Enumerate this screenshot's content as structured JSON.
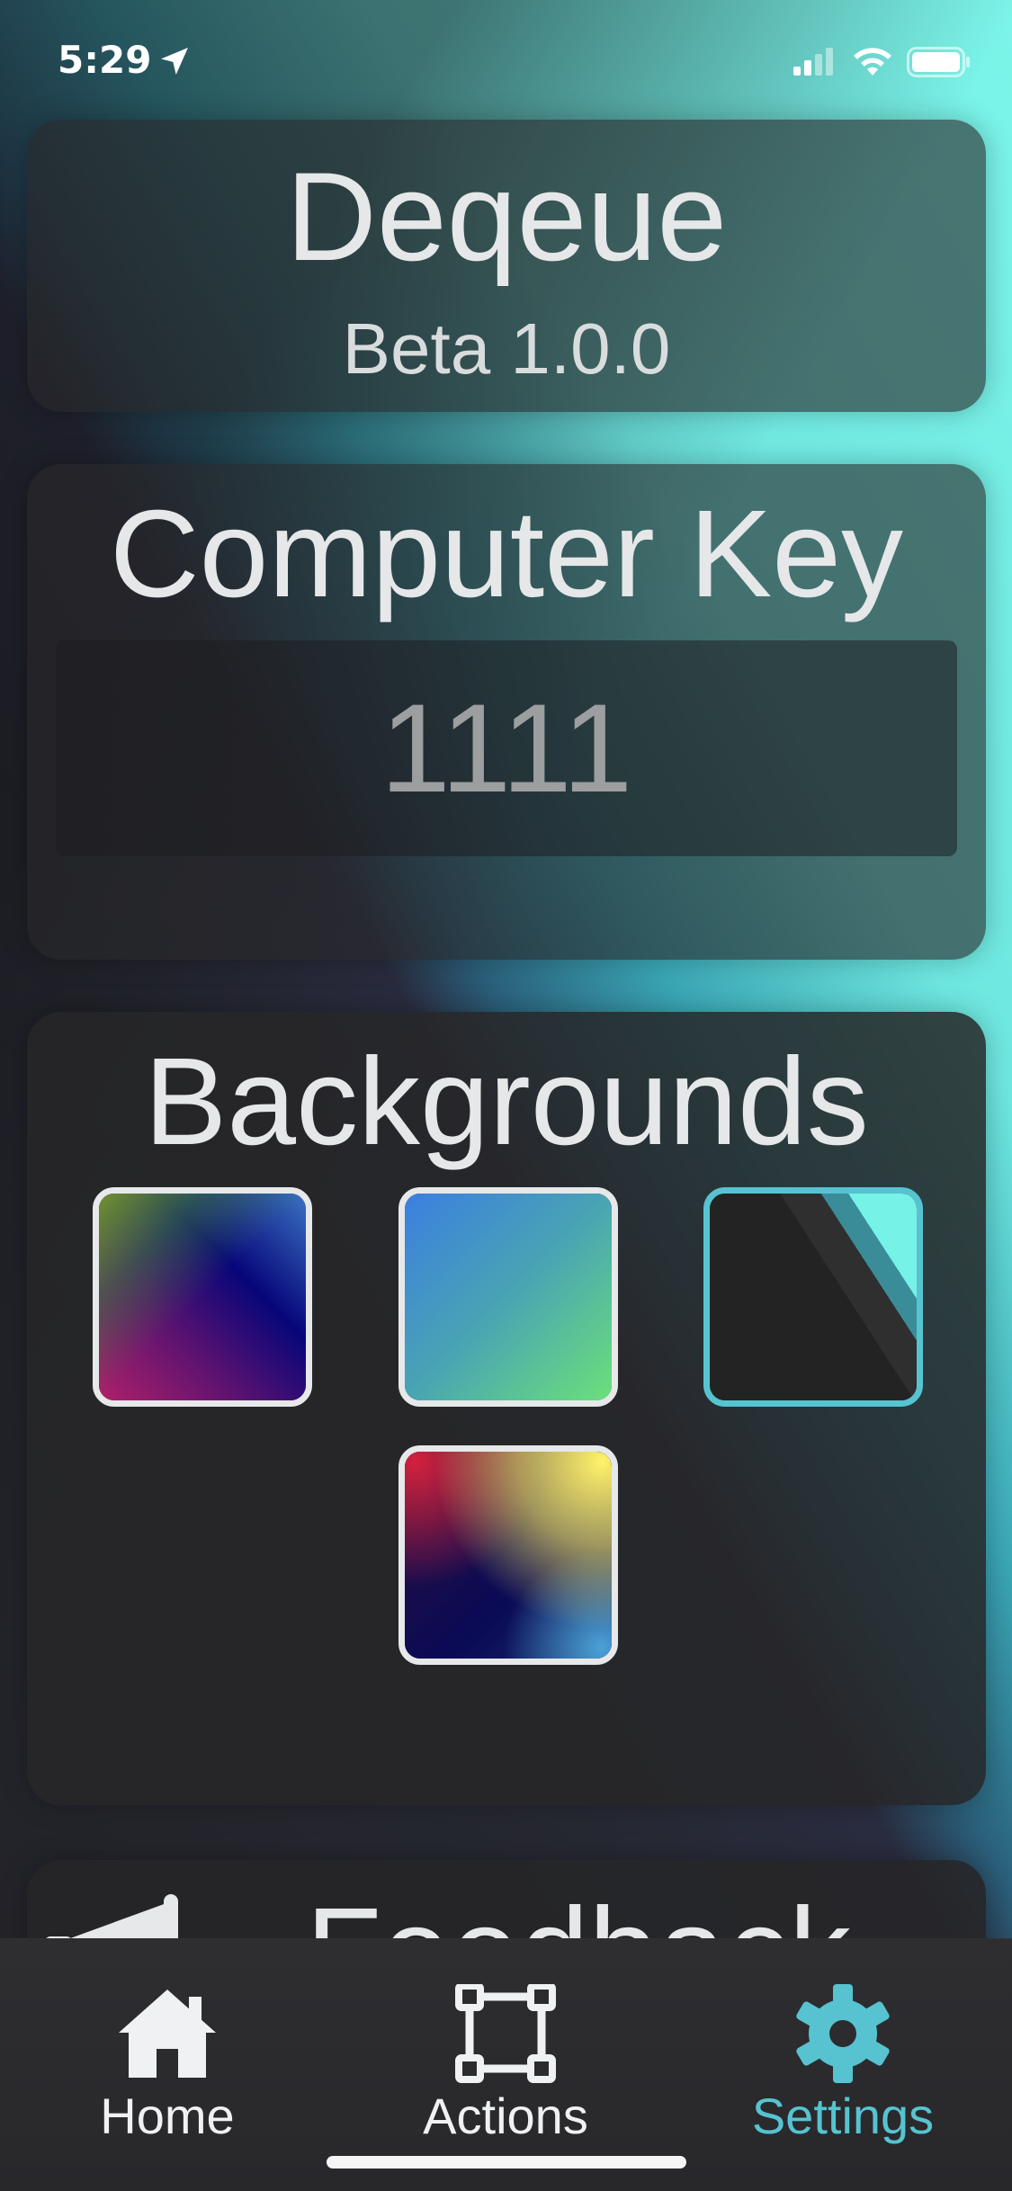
{
  "status_bar": {
    "time": "5:29",
    "icons": [
      "location-arrow-icon",
      "signal-icon",
      "wifi-icon",
      "battery-icon"
    ]
  },
  "app": {
    "name": "Deqeue",
    "version": "Beta 1.0.0"
  },
  "computer_key": {
    "title": "Computer Key",
    "value": "1111"
  },
  "backgrounds": {
    "title": "Backgrounds",
    "options": [
      {
        "name": "green-purple-blue",
        "selected": false
      },
      {
        "name": "blue-green",
        "selected": false
      },
      {
        "name": "dark-teal-stripes",
        "selected": true
      },
      {
        "name": "red-yellow-navy",
        "selected": false
      }
    ],
    "selected_border_color": "#57c3d1"
  },
  "feedback": {
    "title": "Feedback",
    "icon": "megaphone-icon"
  },
  "tabbar": {
    "active": "Settings",
    "accent_color": "#57c3d1",
    "items": [
      {
        "label": "Home",
        "icon": "home-icon"
      },
      {
        "label": "Actions",
        "icon": "vector-square-icon"
      },
      {
        "label": "Settings",
        "icon": "gear-icon"
      }
    ]
  }
}
